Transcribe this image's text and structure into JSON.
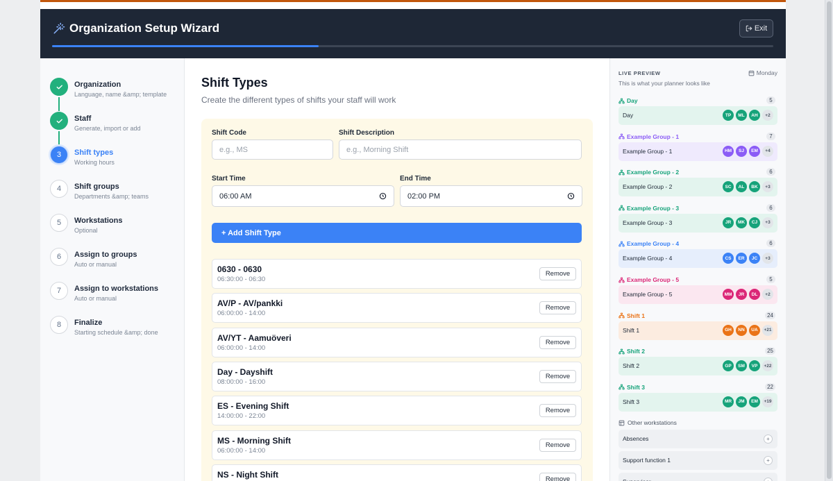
{
  "header": {
    "title": "Organization Setup Wizard",
    "exit_label": "Exit",
    "progress_fraction": 0.37
  },
  "steps": [
    {
      "number": "1",
      "label": "Organization",
      "sub": "Language, name &amp; template",
      "state": "done"
    },
    {
      "number": "2",
      "label": "Staff",
      "sub": "Generate, import or add",
      "state": "done"
    },
    {
      "number": "3",
      "label": "Shift types",
      "sub": "Working hours",
      "state": "active"
    },
    {
      "number": "4",
      "label": "Shift groups",
      "sub": "Departments &amp; teams",
      "state": "todo"
    },
    {
      "number": "5",
      "label": "Workstations",
      "sub": "Optional",
      "state": "todo"
    },
    {
      "number": "6",
      "label": "Assign to groups",
      "sub": "Auto or manual",
      "state": "todo"
    },
    {
      "number": "7",
      "label": "Assign to workstations",
      "sub": "Auto or manual",
      "state": "todo"
    },
    {
      "number": "8",
      "label": "Finalize",
      "sub": "Starting schedule &amp; done",
      "state": "todo"
    }
  ],
  "main": {
    "title": "Shift Types",
    "description": "Create the different types of shifts your staff will work",
    "form": {
      "code_label": "Shift Code",
      "code_placeholder": "e.g., MS",
      "desc_label": "Shift Description",
      "desc_placeholder": "e.g., Morning Shift",
      "start_label": "Start Time",
      "start_value": "06:00 AM",
      "end_label": "End Time",
      "end_value": "02:00 PM",
      "add_label": "+ Add Shift Type"
    },
    "remove_label": "Remove",
    "shifts": [
      {
        "name": "0630 - 0630",
        "time": "06:30:00 - 06:30"
      },
      {
        "name": "AV/P - AV/pankki",
        "time": "06:00:00 - 14:00"
      },
      {
        "name": "AV/YT - Aamuöveri",
        "time": "06:00:00 - 14:00"
      },
      {
        "name": "Day - Dayshift",
        "time": "08:00:00 - 16:00"
      },
      {
        "name": "ES - Evening Shift",
        "time": "14:00:00 - 22:00"
      },
      {
        "name": "MS - Morning Shift",
        "time": "06:00:00 - 14:00"
      },
      {
        "name": "NS - Night Shift",
        "time": ""
      }
    ]
  },
  "preview": {
    "title": "LIVE PREVIEW",
    "subtitle": "This is what your planner looks like",
    "day": "Monday",
    "groups": [
      {
        "name": "Day",
        "count": "5",
        "row": "Day",
        "color": "#16a37a",
        "bg": "#e3f4ee",
        "avatars": [
          "TP",
          "ML",
          "AH"
        ],
        "more": "+2"
      },
      {
        "name": "Example Group - 1",
        "count": "7",
        "row": "Example Group - 1",
        "color": "#8b5cf6",
        "bg": "#efeafd",
        "avatars": [
          "HM",
          "SJ",
          "EM"
        ],
        "more": "+4"
      },
      {
        "name": "Example Group - 2",
        "count": "6",
        "row": "Example Group - 2",
        "color": "#16a37a",
        "bg": "#e3f4ee",
        "avatars": [
          "SC",
          "AL",
          "BK"
        ],
        "more": "+3"
      },
      {
        "name": "Example Group - 3",
        "count": "6",
        "row": "Example Group - 3",
        "color": "#16a37a",
        "bg": "#e3f4ee",
        "avatars": [
          "JR",
          "MK",
          "CJ"
        ],
        "more": "+3"
      },
      {
        "name": "Example Group - 4",
        "count": "6",
        "row": "Example Group - 4",
        "color": "#3b82f6",
        "bg": "#e6eefc",
        "avatars": [
          "CS",
          "ER",
          "JC"
        ],
        "more": "+3"
      },
      {
        "name": "Example Group - 5",
        "count": "5",
        "row": "Example Group - 5",
        "color": "#db2777",
        "bg": "#fbe7f0",
        "avatars": [
          "MM",
          "JR",
          "DL"
        ],
        "more": "+2"
      },
      {
        "name": "Shift 1",
        "count": "24",
        "row": "Shift 1",
        "color": "#ea7317",
        "bg": "#fcece0",
        "avatars": [
          "GH",
          "NN",
          "UA"
        ],
        "more": "+21"
      },
      {
        "name": "Shift 2",
        "count": "25",
        "row": "Shift 2",
        "color": "#16a37a",
        "bg": "#e3f4ee",
        "avatars": [
          "GP",
          "SM",
          "VP"
        ],
        "more": "+22"
      },
      {
        "name": "Shift 3",
        "count": "22",
        "row": "Shift 3",
        "color": "#16a37a",
        "bg": "#e3f4ee",
        "avatars": [
          "MR",
          "JM",
          "EM"
        ],
        "more": "+19"
      }
    ],
    "other_title": "Other workstations",
    "other_items": [
      "Absences",
      "Support function 1",
      "Supervisor"
    ]
  }
}
